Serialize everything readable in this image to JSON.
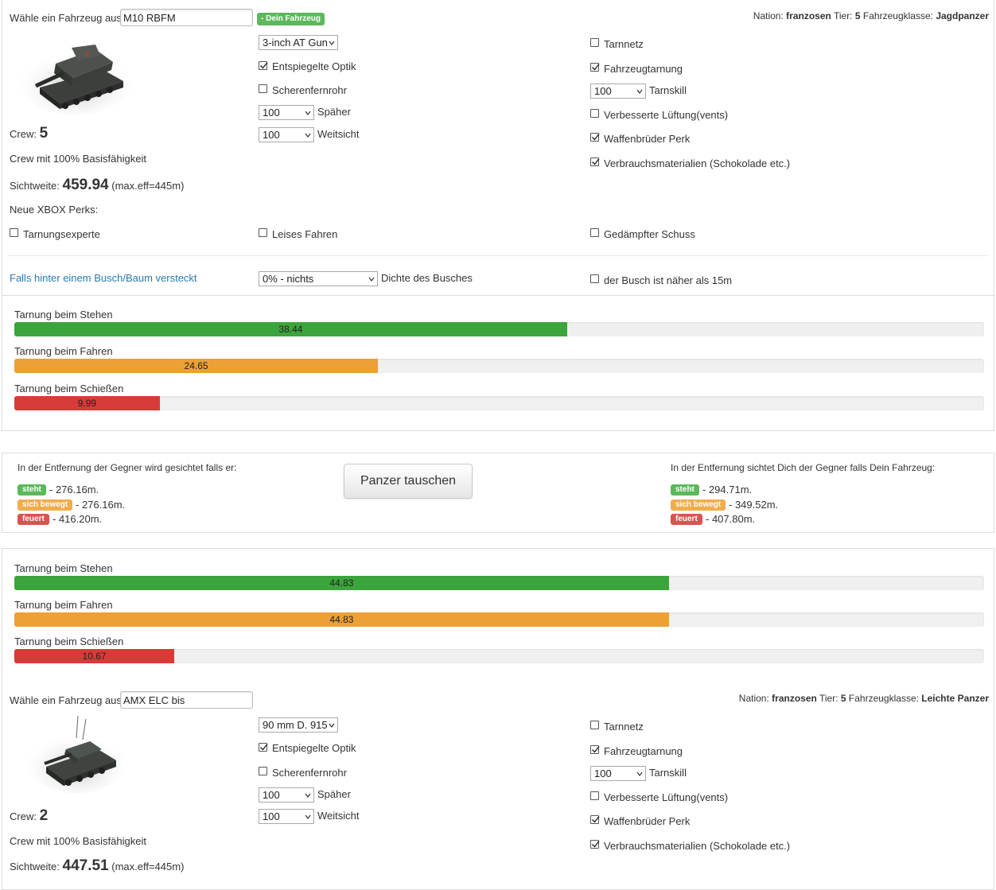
{
  "vehicle1": {
    "select_label": "Wähle ein Fahrzeug aus:",
    "name": "M10 RBFM",
    "badge": "- Dein Fahrzeug",
    "nation_label": "Nation:",
    "nation": "franzosen",
    "tier_label": "Tier:",
    "tier": "5",
    "class_label": "Fahrzeugklasse:",
    "class": "Jagdpanzer",
    "gun": "3-inch AT Gun",
    "optics_label": "Entspiegelte Optik",
    "optics_checked": true,
    "periscope_label": "Scherenfernrohr",
    "periscope_checked": false,
    "recon_value": "100",
    "recon_label": "Späher",
    "situational_value": "100",
    "situational_label": "Weitsicht",
    "camo_net_label": "Tarnnetz",
    "camo_net_checked": false,
    "vehicle_camo_label": "Fahrzeugtarnung",
    "vehicle_camo_checked": true,
    "camo_skill_value": "100",
    "camo_skill_label": "Tarnskill",
    "vents_label": "Verbesserte Lüftung(vents)",
    "vents_checked": false,
    "bia_label": "Waffenbrüder Perk",
    "bia_checked": true,
    "consumables_label": "Verbrauchsmaterialien (Schokolade etc.)",
    "consumables_checked": true,
    "crew_label": "Crew:",
    "crew": "5",
    "crew_desc": "Crew mit 100% Basisfähigkeit",
    "view_label": "Sichtweite:",
    "view": "459.94",
    "view_max": "(max.eff=445m)",
    "xbox_perks_label": "Neue XBOX Perks:",
    "perk1_label": "Tarnungsexperte",
    "perk1_checked": false,
    "perk2_label": "Leises Fahren",
    "perk2_checked": false,
    "perk3_label": "Gedämpfter Schuss",
    "perk3_checked": false,
    "bush_link": "Falls hinter einem Busch/Baum versteckt",
    "bush_value": "0% - nichts",
    "bush_label": "Dichte des Busches",
    "bush_near_label": "der Busch ist näher als 15m",
    "bush_near_checked": false
  },
  "bars1": [
    {
      "label": "Tarnung beim Stehen",
      "value": "38.44",
      "fraction": 0.57,
      "color": "#3ca43c"
    },
    {
      "label": "Tarnung beim Fahren",
      "value": "24.65",
      "fraction": 0.375,
      "color": "#eca035"
    },
    {
      "label": "Tarnung beim Schießen",
      "value": "9.99",
      "fraction": 0.15,
      "color": "#d73b38"
    }
  ],
  "distance": {
    "left_title": "In der Entfernung der Gegner wird gesichtet falls er:",
    "right_title": "In der Entfernung sichtet Dich der Gegner falls Dein Fahrzeug:",
    "button": "Panzer tauschen",
    "left": [
      {
        "tag": "steht",
        "value": "- 276.16m."
      },
      {
        "tag": "sich bewegt",
        "value": "- 276.16m."
      },
      {
        "tag": "feuert",
        "value": "- 416.20m."
      }
    ],
    "right": [
      {
        "tag": "steht",
        "value": "- 294.71m."
      },
      {
        "tag": "sich bewegt",
        "value": "- 349.52m."
      },
      {
        "tag": "feuert",
        "value": "- 407.80m."
      }
    ]
  },
  "bars2": [
    {
      "label": "Tarnung beim Stehen",
      "value": "44.83",
      "fraction": 0.675,
      "color": "#3ca43c"
    },
    {
      "label": "Tarnung beim Fahren",
      "value": "44.83",
      "fraction": 0.675,
      "color": "#eca035"
    },
    {
      "label": "Tarnung beim Schießen",
      "value": "10.67",
      "fraction": 0.165,
      "color": "#d73b38"
    }
  ],
  "vehicle2": {
    "select_label": "Wähle ein Fahrzeug aus:",
    "name": "AMX ELC bis",
    "nation_label": "Nation:",
    "nation": "franzosen",
    "tier_label": "Tier:",
    "tier": "5",
    "class_label": "Fahrzeugklasse:",
    "class": "Leichte Panzer",
    "gun": "90 mm D. 915",
    "optics_label": "Entspiegelte Optik",
    "optics_checked": true,
    "periscope_label": "Scherenfernrohr",
    "periscope_checked": false,
    "recon_value": "100",
    "recon_label": "Späher",
    "situational_value": "100",
    "situational_label": "Weitsicht",
    "camo_net_label": "Tarnnetz",
    "camo_net_checked": false,
    "vehicle_camo_label": "Fahrzeugtarnung",
    "vehicle_camo_checked": true,
    "camo_skill_value": "100",
    "camo_skill_label": "Tarnskill",
    "vents_label": "Verbesserte Lüftung(vents)",
    "vents_checked": false,
    "bia_label": "Waffenbrüder Perk",
    "bia_checked": true,
    "consumables_label": "Verbrauchsmaterialien (Schokolade etc.)",
    "consumables_checked": true,
    "crew_label": "Crew:",
    "crew": "2",
    "crew_desc": "Crew mit 100% Basisfähigkeit",
    "view_label": "Sichtweite:",
    "view": "447.51",
    "view_max": "(max.eff=445m)"
  }
}
